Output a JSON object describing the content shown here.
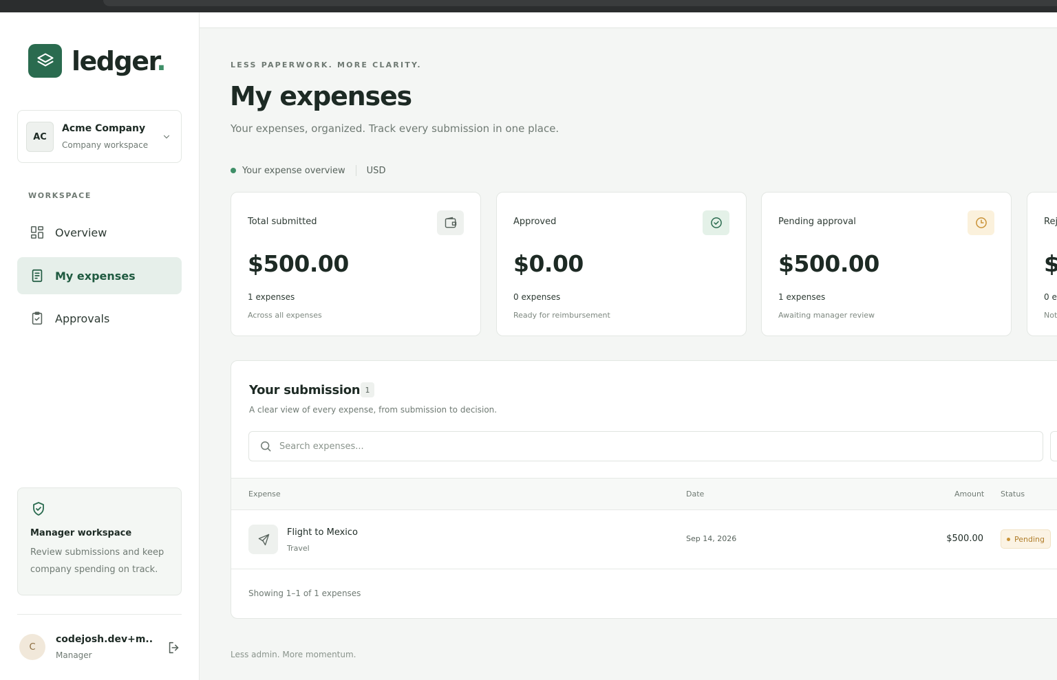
{
  "app": {
    "name": "ledger",
    "name_dot": "."
  },
  "company": {
    "initials": "AC",
    "name": "Acme Company",
    "subtitle": "Company workspace"
  },
  "sidebar": {
    "section_label": "WORKSPACE",
    "items": [
      {
        "label": "Overview",
        "icon": "grid-icon",
        "active": false
      },
      {
        "label": "My expenses",
        "icon": "receipt-icon",
        "active": true
      },
      {
        "label": "Approvals",
        "icon": "clipboard-check-icon",
        "active": false
      }
    ],
    "manager_card": {
      "icon": "shield-check-icon",
      "title": "Manager workspace",
      "description": "Review submissions and keep company spending on track."
    },
    "user": {
      "initial": "C",
      "name": "codejosh.dev+m...",
      "role": "Manager"
    }
  },
  "header": {
    "eyebrow": "LESS PAPERWORK. MORE CLARITY.",
    "title": "My expenses",
    "subtitle": "Your expenses, organized. Track every submission in one place.",
    "overview_label": "Your expense overview",
    "currency": "USD"
  },
  "stats": [
    {
      "label": "Total submitted",
      "amount": "$500.00",
      "count": "1 expenses",
      "note": "Across all expenses",
      "icon": "wallet-icon",
      "accent": "#eef1ee",
      "icon_color": "#56625b"
    },
    {
      "label": "Approved",
      "amount": "$0.00",
      "count": "0 expenses",
      "note": "Ready for reimbursement",
      "icon": "check-circle-icon",
      "accent": "#e4f1e8",
      "icon_color": "#2a6b4f"
    },
    {
      "label": "Pending approval",
      "amount": "$500.00",
      "count": "1 expenses",
      "note": "Awaiting manager review",
      "icon": "clock-icon",
      "accent": "#fbf1dc",
      "icon_color": "#c99236"
    },
    {
      "label": "Rej",
      "amount": "$",
      "count": "0 e",
      "note": "Not",
      "icon": "x-circle-icon",
      "accent": "#f8e9e7",
      "icon_color": "#b5544a"
    }
  ],
  "submissions": {
    "title": "Your submissions",
    "count": "1",
    "description": "A clear view of every expense, from submission to decision.",
    "search_placeholder": "Search expenses...",
    "columns": {
      "expense": "Expense",
      "date": "Date",
      "amount": "Amount",
      "status": "Status"
    },
    "rows": [
      {
        "name": "Flight to Mexico",
        "category": "Travel",
        "date": "Sep 14, 2026",
        "amount": "$500.00",
        "status": "Pending",
        "icon": "plane-icon"
      }
    ],
    "footer": "Showing 1–1 of 1 expenses"
  },
  "tagline": "Less admin. More momentum.",
  "colors": {
    "brand": "#2a6b4f",
    "pending": "#c99236"
  }
}
